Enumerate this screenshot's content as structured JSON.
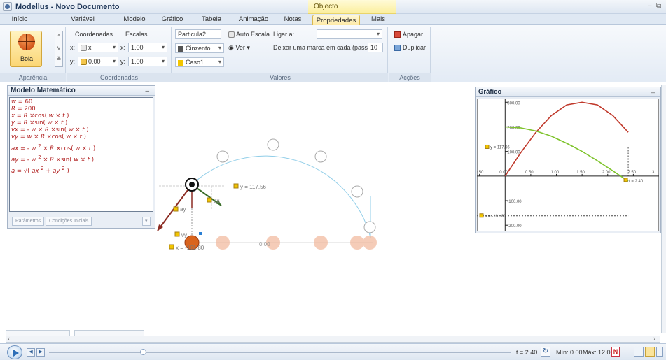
{
  "window": {
    "title": "Modellus - Novo Documento",
    "context_tab": "Objecto",
    "minimize": "–",
    "restore": "⧉"
  },
  "tabs": [
    "Início",
    "Variável Independente",
    "Modelo",
    "Gráfico",
    "Tabela",
    "Animação",
    "Notas",
    "Propriedades",
    "Mais"
  ],
  "ribbon": {
    "appearance": {
      "button": "Bola",
      "group": "Aparência"
    },
    "coordinates": {
      "label": "Coordenadas",
      "x_var": "x",
      "y_var": "0.00",
      "x_prefix": "x:",
      "y_prefix": "y:",
      "group": "Coordenadas"
    },
    "scales": {
      "label": "Escalas",
      "x_prefix": "x:",
      "x": "1.00",
      "y_prefix": "y:",
      "y": "1.00"
    },
    "values": {
      "name": "Particula2",
      "color": "Cinzento",
      "case": "Caso1",
      "auto_scale": "Auto Escala",
      "view": "Ver",
      "link_to": "Ligar a:",
      "mark_every": "Deixar uma marca em cada (passos):",
      "mark_every_value": "10",
      "group": "Valores"
    },
    "actions": {
      "delete": "Apagar",
      "duplicate": "Duplicar",
      "group": "Acções"
    }
  },
  "model_panel": {
    "title": "Modelo Matemático",
    "buttons": [
      "Parâmetros",
      "Condições Iniciais"
    ]
  },
  "simulation": {
    "labels": {
      "y_marker": "y = 117.56",
      "ax": "ax",
      "ay": "ay",
      "vy": "vy",
      "x_marker": "x = -161.80",
      "origin": "0.00"
    }
  },
  "graph_panel": {
    "title": "Gráfico",
    "y_tick_labels": [
      "300.00",
      "200.00",
      "100.00",
      "-100.00",
      "-200.00"
    ],
    "x_tick_labels": [
      "-0.50",
      "0.00",
      "0.50",
      "1.00",
      "1.50",
      "2.00",
      "2.50",
      "3."
    ],
    "markers": {
      "y": "y = 117.56",
      "a": "a = -161.80",
      "t": "t = 2.40"
    }
  },
  "chart_data": {
    "type": "line",
    "x": [
      0.0,
      0.3,
      0.6,
      0.9,
      1.2,
      1.5,
      1.8,
      2.1,
      2.4
    ],
    "series": [
      {
        "values": [
          0,
          94,
          178,
          246,
          289,
          300,
          289,
          246,
          178
        ]
      },
      {
        "values": [
          200,
          196,
          183,
          162,
          133,
          100,
          62,
          21,
          -21
        ]
      }
    ],
    "xlim": [
      -0.55,
      3.0
    ],
    "ylim": [
      -225,
      315
    ],
    "colors": [
      "#c0392b",
      "#7ec32b"
    ],
    "grid": false
  },
  "playbar": {
    "time": "t = 2.40",
    "min": "Mín: 0.00",
    "max": "Máx: 12.00"
  }
}
